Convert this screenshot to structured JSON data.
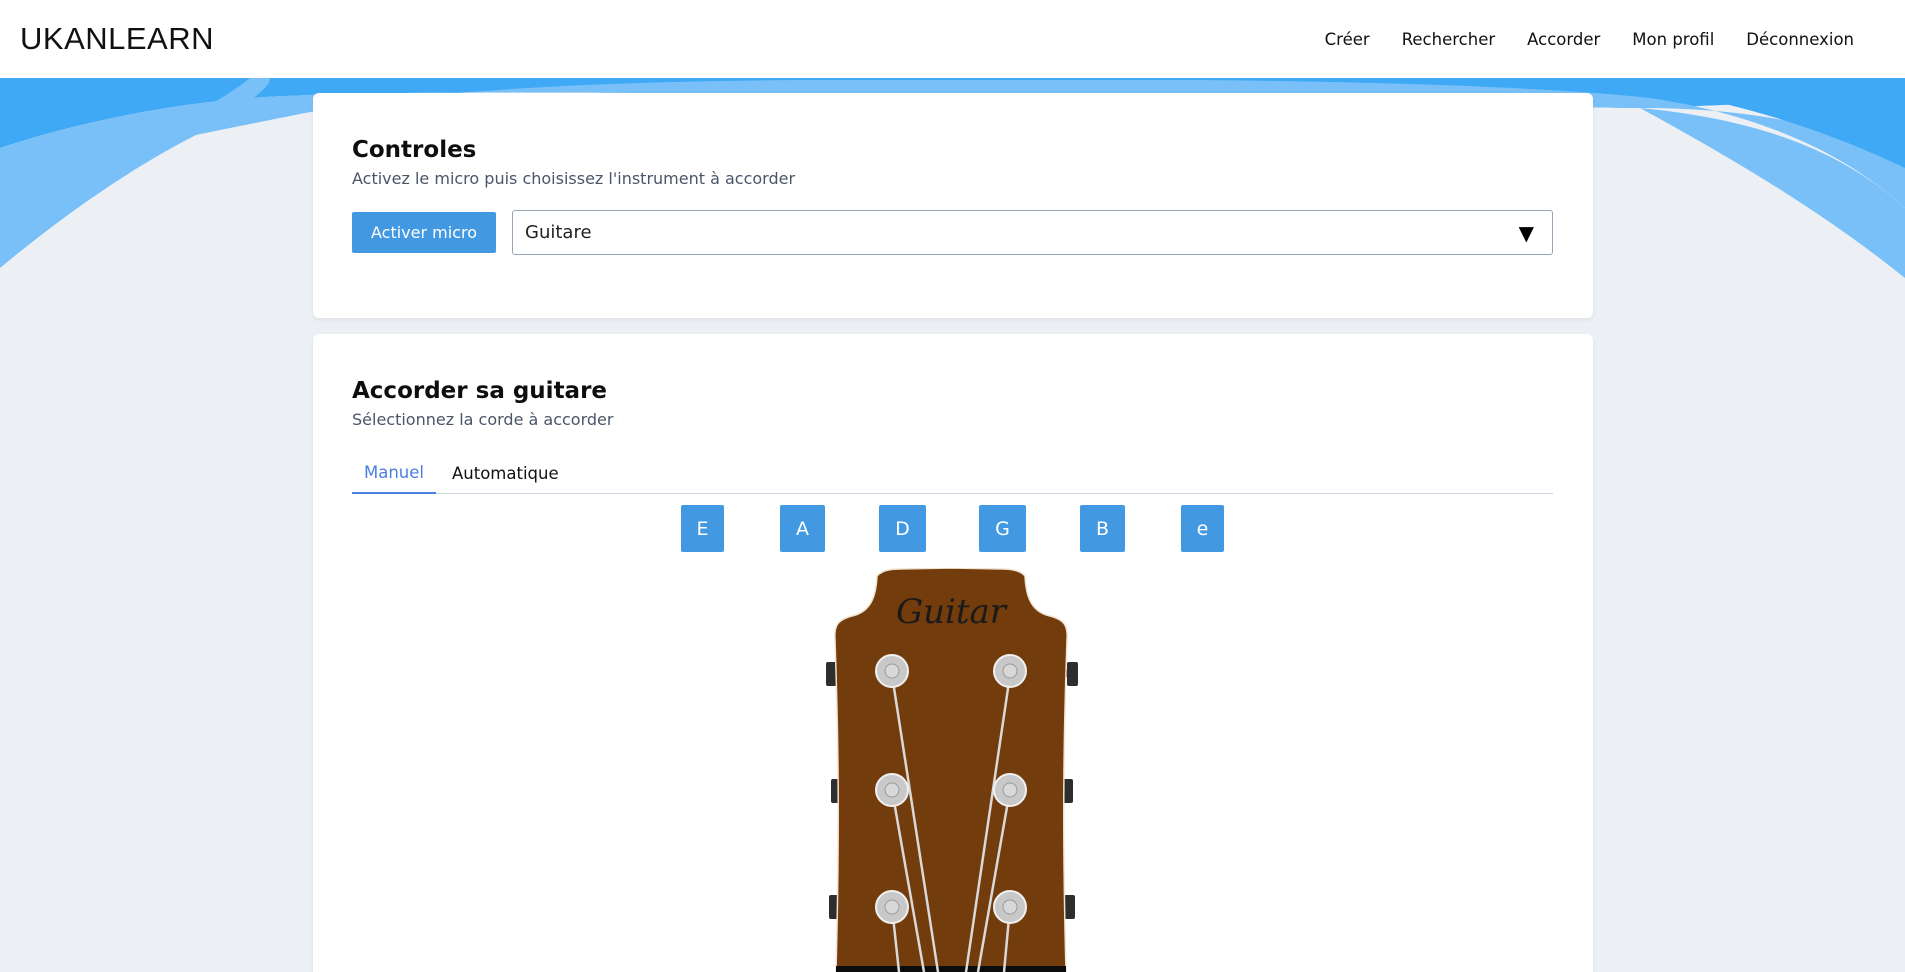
{
  "brand": "UKANLEARN",
  "nav": [
    {
      "label": "Créer"
    },
    {
      "label": "Rechercher"
    },
    {
      "label": "Accorder"
    },
    {
      "label": "Mon profil"
    },
    {
      "label": "Déconnexion"
    }
  ],
  "controls": {
    "title": "Controles",
    "subtitle": "Activez le micro puis choisissez l'instrument à accorder",
    "mic_button": "Activer micro",
    "instrument_selected": "Guitare",
    "dropdown_arrow": "▼"
  },
  "tuner": {
    "title": "Accorder sa guitare",
    "subtitle": "Sélectionnez la corde à accorder",
    "tabs": [
      {
        "label": "Manuel",
        "active": true
      },
      {
        "label": "Automatique",
        "active": false
      }
    ],
    "strings": [
      "E",
      "A",
      "D",
      "G",
      "B",
      "e"
    ],
    "headstock_label": "Guitar"
  },
  "colors": {
    "accent": "#4299e1",
    "tab_active": "#4a7ee0",
    "headstock": "#733c0c",
    "wave_dark": "#3fa9f5",
    "wave_light": "#79c0f8"
  }
}
